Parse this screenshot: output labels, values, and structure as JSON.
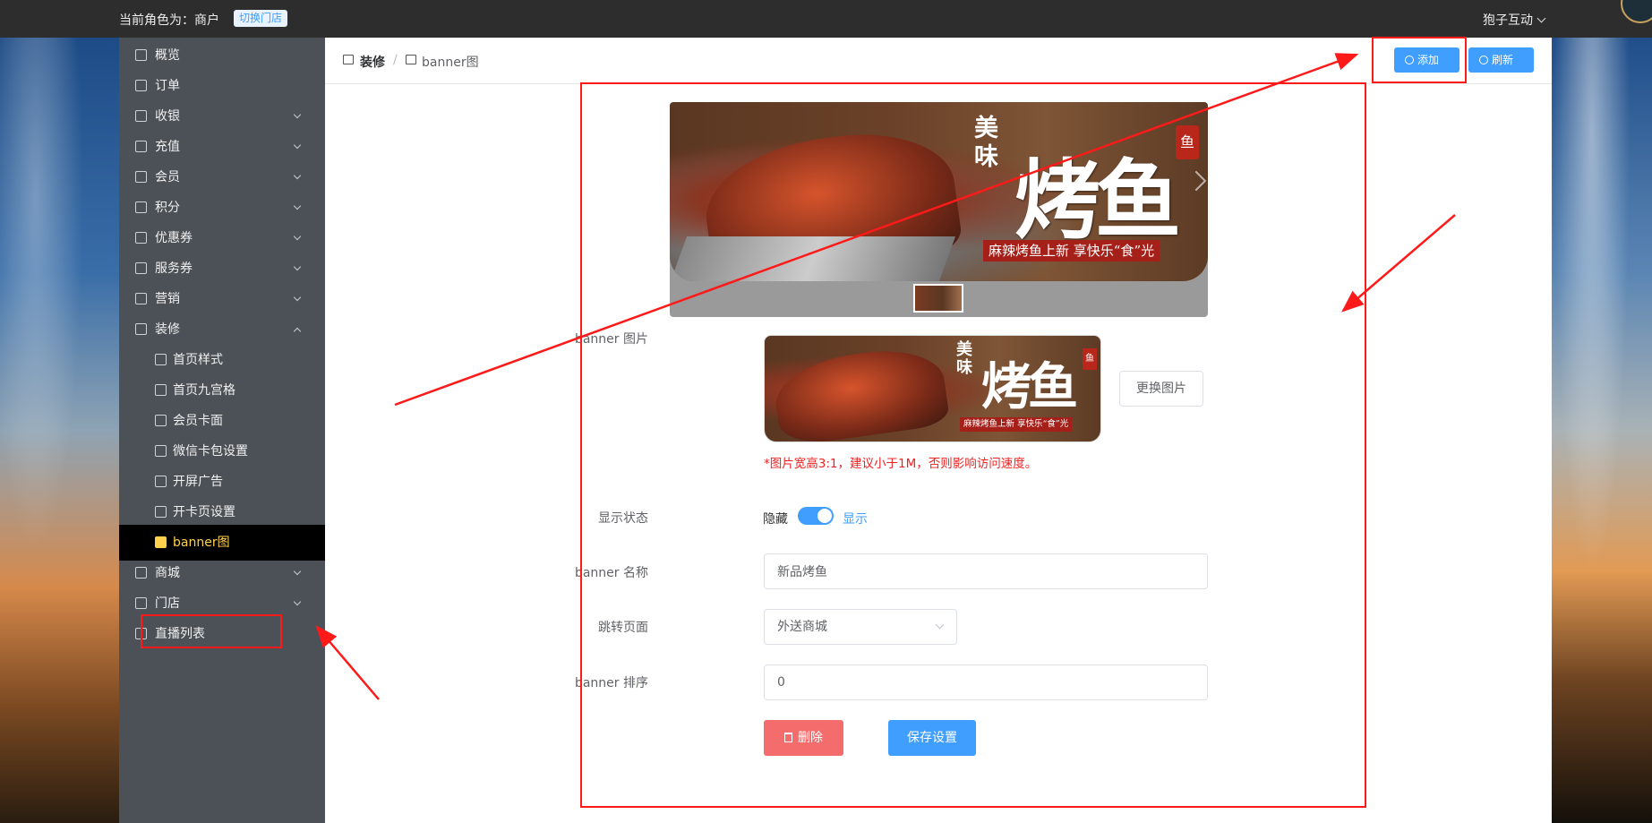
{
  "topbar": {
    "role_text": "当前角色为：商户",
    "switch_store": "切换门店",
    "brand": "狍子互动"
  },
  "sidebar": {
    "items": [
      {
        "label": "概览",
        "icon": "home-icon"
      },
      {
        "label": "订单",
        "icon": "order-icon"
      },
      {
        "label": "收银",
        "icon": "cashier-icon"
      },
      {
        "label": "充值",
        "icon": "recharge-icon"
      },
      {
        "label": "会员",
        "icon": "member-icon"
      },
      {
        "label": "积分",
        "icon": "points-icon"
      },
      {
        "label": "优惠券",
        "icon": "coupon-icon"
      },
      {
        "label": "服务券",
        "icon": "ticket-icon"
      },
      {
        "label": "营销",
        "icon": "marketing-icon"
      },
      {
        "label": "装修",
        "icon": "decorate-icon"
      },
      {
        "label": "首页样式",
        "icon": "home-icon"
      },
      {
        "label": "首页九宫格",
        "icon": "grid-icon"
      },
      {
        "label": "会员卡面",
        "icon": "card-icon"
      },
      {
        "label": "微信卡包设置",
        "icon": "wallet-icon"
      },
      {
        "label": "开屏广告",
        "icon": "phone-icon"
      },
      {
        "label": "开卡页设置",
        "icon": "card-page-icon"
      },
      {
        "label": "banner图",
        "icon": "image-icon"
      },
      {
        "label": "商城",
        "icon": "shop-icon"
      },
      {
        "label": "门店",
        "icon": "store-icon"
      },
      {
        "label": "直播列表",
        "icon": "list-icon"
      }
    ]
  },
  "breadcrumb": {
    "level1": "装修",
    "level2": "banner图"
  },
  "toolbar": {
    "add_label": "添加",
    "refresh_label": "刷新"
  },
  "carousel": {
    "title_small": "美味",
    "title_big": "烤鱼",
    "seal": "鱼",
    "tagline": "麻辣烤鱼上新   享快乐“食”光"
  },
  "form": {
    "banner_image_label": "banner 图片",
    "change_image_label": "更换图片",
    "image_hint": "*图片宽高3:1，建议小于1M，否则影响访问速度。",
    "status_label": "显示状态",
    "status_off": "隐藏",
    "status_on": "显示",
    "status_value": true,
    "name_label": "banner 名称",
    "name_value": "新品烤鱼",
    "jump_label": "跳转页面",
    "jump_value": "外送商城",
    "sort_label": "banner 排序",
    "sort_value": "0",
    "delete_label": "删除",
    "save_label": "保存设置"
  },
  "colors": {
    "primary": "#409eff",
    "danger": "#f56c6c",
    "sidebar_bg": "#4b5156",
    "active_text": "#ffd04b",
    "annotation": "#ff1a1a"
  }
}
